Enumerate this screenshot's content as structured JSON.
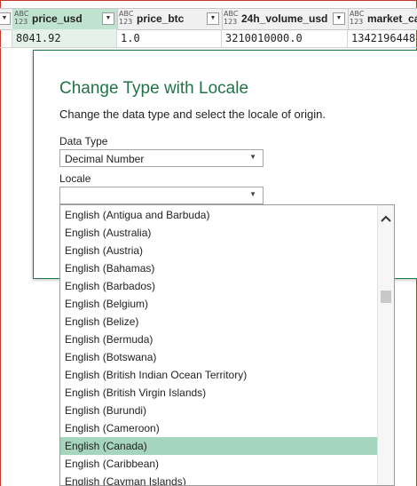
{
  "grid": {
    "type_icon": "ABC 123",
    "columns": [
      {
        "name": "price_usd"
      },
      {
        "name": "price_btc"
      },
      {
        "name": "24h_volume_usd"
      },
      {
        "name": "market_ca"
      }
    ],
    "row": [
      "8041.92",
      "1.0",
      "3210010000.0",
      "1342196448"
    ]
  },
  "dialog": {
    "title": "Change Type with Locale",
    "subtitle": "Change the data type and select the locale of origin.",
    "data_type_label": "Data Type",
    "data_type_value": "Decimal Number",
    "locale_label": "Locale",
    "locale_value": ""
  },
  "locale_list": {
    "selected": "English (Canada)",
    "items": [
      "English (Antigua and Barbuda)",
      "English (Australia)",
      "English (Austria)",
      "English (Bahamas)",
      "English (Barbados)",
      "English (Belgium)",
      "English (Belize)",
      "English (Bermuda)",
      "English (Botswana)",
      "English (British Indian Ocean Territory)",
      "English (British Virgin Islands)",
      "English (Burundi)",
      "English (Cameroon)",
      "English (Canada)",
      "English (Caribbean)",
      "English (Cayman Islands)"
    ]
  },
  "icons": {
    "filter": "filter-dropdown-icon",
    "dropdown": "chevron-down-icon",
    "scroll_up": "chevron-up-icon"
  }
}
